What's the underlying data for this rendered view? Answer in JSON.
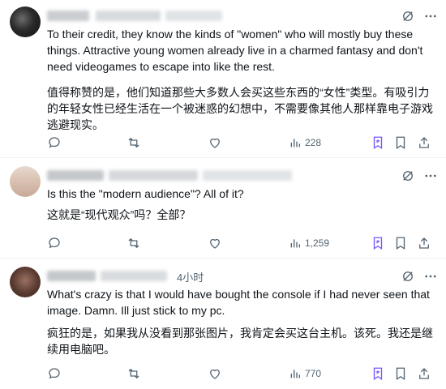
{
  "posts": [
    {
      "time": "",
      "text_en": "To their credit, they know the kinds of \"women\" who will mostly buy these things. Attractive young women already live in a charmed fantasy and don't need videogames to escape into like the rest.",
      "text_zh": "值得称赞的是，他们知道那些大多数人会买这些东西的“女性”类型。有吸引力的年轻女性已经生活在一个被迷惑的幻想中，不需要像其他人那样靠电子游戏逃避现实。",
      "views": "228"
    },
    {
      "time": "",
      "text_en": "Is this the \"modern audience\"? All of it?",
      "text_zh": "这就是“现代观众”吗？全部？",
      "views": "1,259"
    },
    {
      "time": "4小时",
      "text_en": "What's crazy is that I would have bought the console if I had never seen that image. Damn. Ill just stick to my pc.",
      "text_zh": "疯狂的是，如果我从没看到那张图片，我肯定会买这台主机。该死。我还是继续用电脑吧。",
      "views": "770"
    }
  ],
  "icons": {
    "header": [
      "grok-icon",
      "more-icon"
    ],
    "actions": [
      "reply-icon",
      "repost-icon",
      "like-icon",
      "views-icon",
      "translate-icon",
      "bookmark-icon",
      "share-icon"
    ]
  },
  "colors": {
    "text": "#0f1419",
    "secondary": "#536471",
    "accent": "#7856ff",
    "divider": "#eff3f4"
  }
}
